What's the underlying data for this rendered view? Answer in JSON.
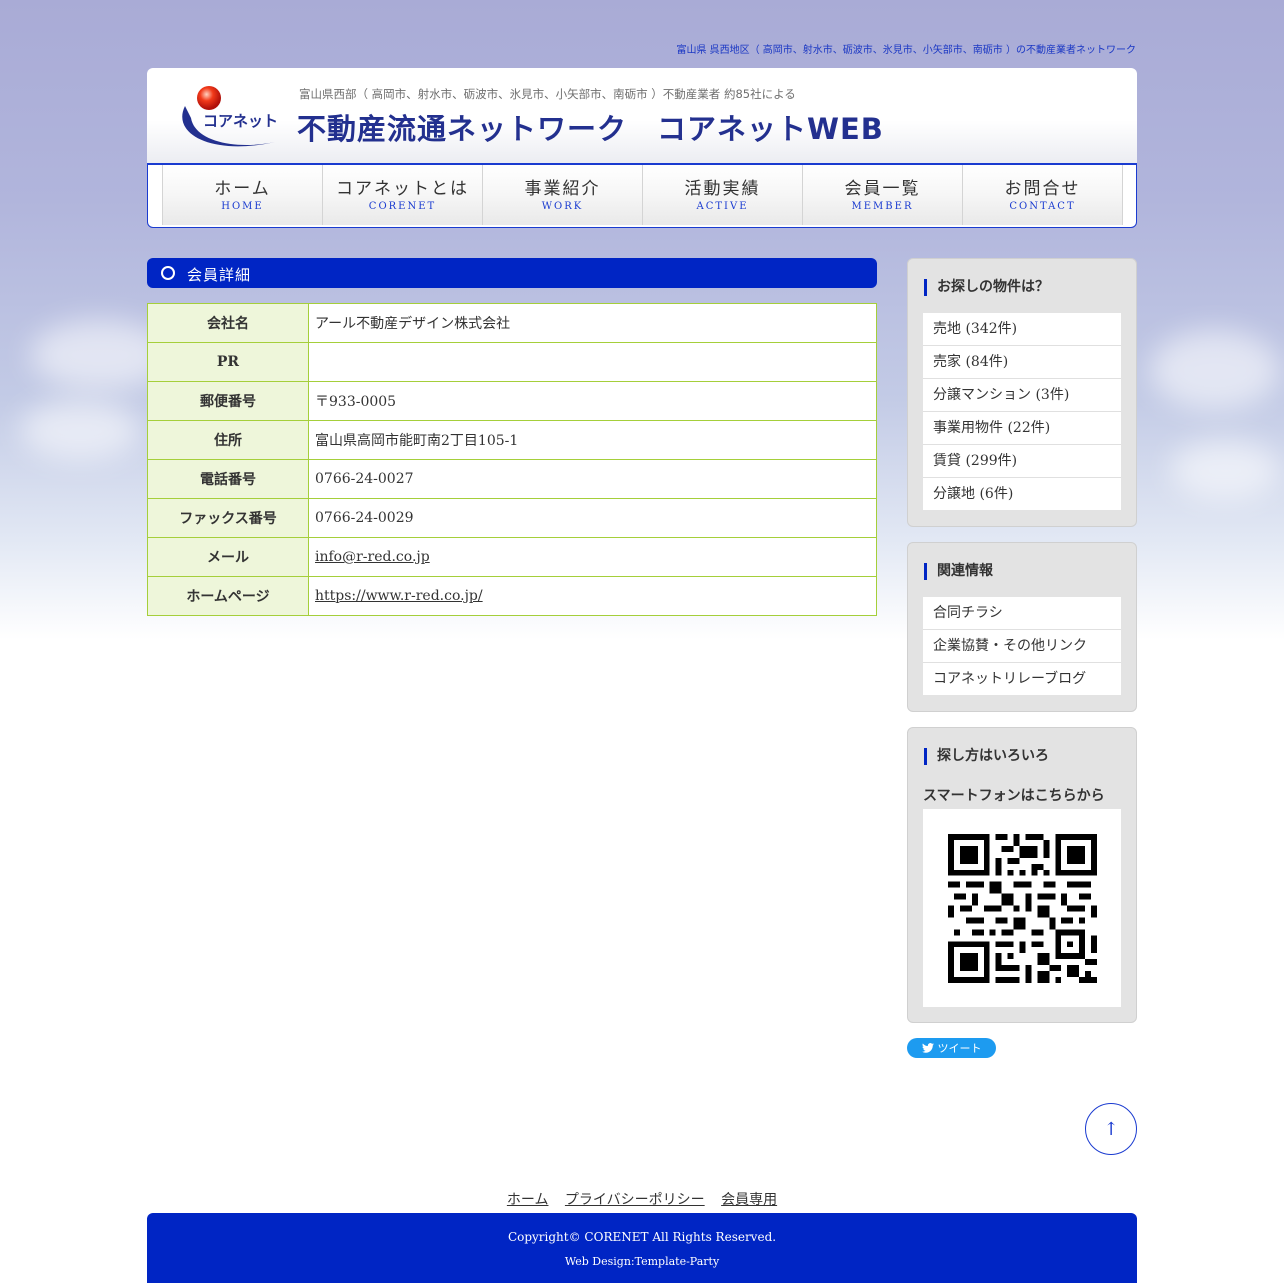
{
  "tagline": "富山県 呉西地区（ 高岡市、射水市、砺波市、氷見市、小矢部市、南砺市 ）の不動産業者ネットワーク",
  "header": {
    "logo_text": "コアネット",
    "subtitle": "富山県西部（ 高岡市、射水市、砺波市、氷見市、小矢部市、南砺市 ）不動産業者 約85社による",
    "title": "不動産流通ネットワーク　コアネットWEB"
  },
  "nav": [
    {
      "jp": "ホーム",
      "en": "HOME"
    },
    {
      "jp": "コアネットとは",
      "en": "CORENET"
    },
    {
      "jp": "事業紹介",
      "en": "WORK"
    },
    {
      "jp": "活動実績",
      "en": "ACTIVE"
    },
    {
      "jp": "会員一覧",
      "en": "MEMBER"
    },
    {
      "jp": "お問合せ",
      "en": "CONTACT"
    }
  ],
  "main": {
    "section_title": "会員詳細",
    "rows": [
      {
        "label": "会社名",
        "value": "アール不動産デザイン株式会社"
      },
      {
        "label": "PR",
        "value": ""
      },
      {
        "label": "郵便番号",
        "value": "〒933-0005"
      },
      {
        "label": "住所",
        "value": "富山県高岡市能町南2丁目105-1"
      },
      {
        "label": "電話番号",
        "value": "0766-24-0027"
      },
      {
        "label": "ファックス番号",
        "value": "0766-24-0029"
      },
      {
        "label": "メール",
        "value": "info@r-red.co.jp"
      },
      {
        "label": "ホームページ",
        "value": "https://www.r-red.co.jp/"
      }
    ]
  },
  "sidebar": {
    "search": {
      "title": "お探しの物件は？",
      "items": [
        "売地 (342件)",
        "売家 (84件)",
        "分譲マンション (3件)",
        "事業用物件 (22件)",
        "賃貸 (299件)",
        "分譲地 (6件)"
      ]
    },
    "related": {
      "title": "関連情報",
      "items": [
        "合同チラシ",
        "企業協賛・その他リンク",
        "コアネットリレーブログ"
      ]
    },
    "ways": {
      "title": "探し方はいろいろ",
      "smartphone": "スマートフォンはこちらから"
    }
  },
  "tweet_label": "ツイート",
  "to_top": "↑",
  "footer": {
    "links": [
      "ホーム",
      "プライバシーポリシー",
      "会員専用"
    ],
    "copyright": "Copyright© CORENET All Rights Reserved.",
    "design": "Web Design:Template-Party"
  },
  "colors": {
    "accent": "#0025c4",
    "table_border": "#a5cf3a",
    "table_head": "#eef6da"
  }
}
